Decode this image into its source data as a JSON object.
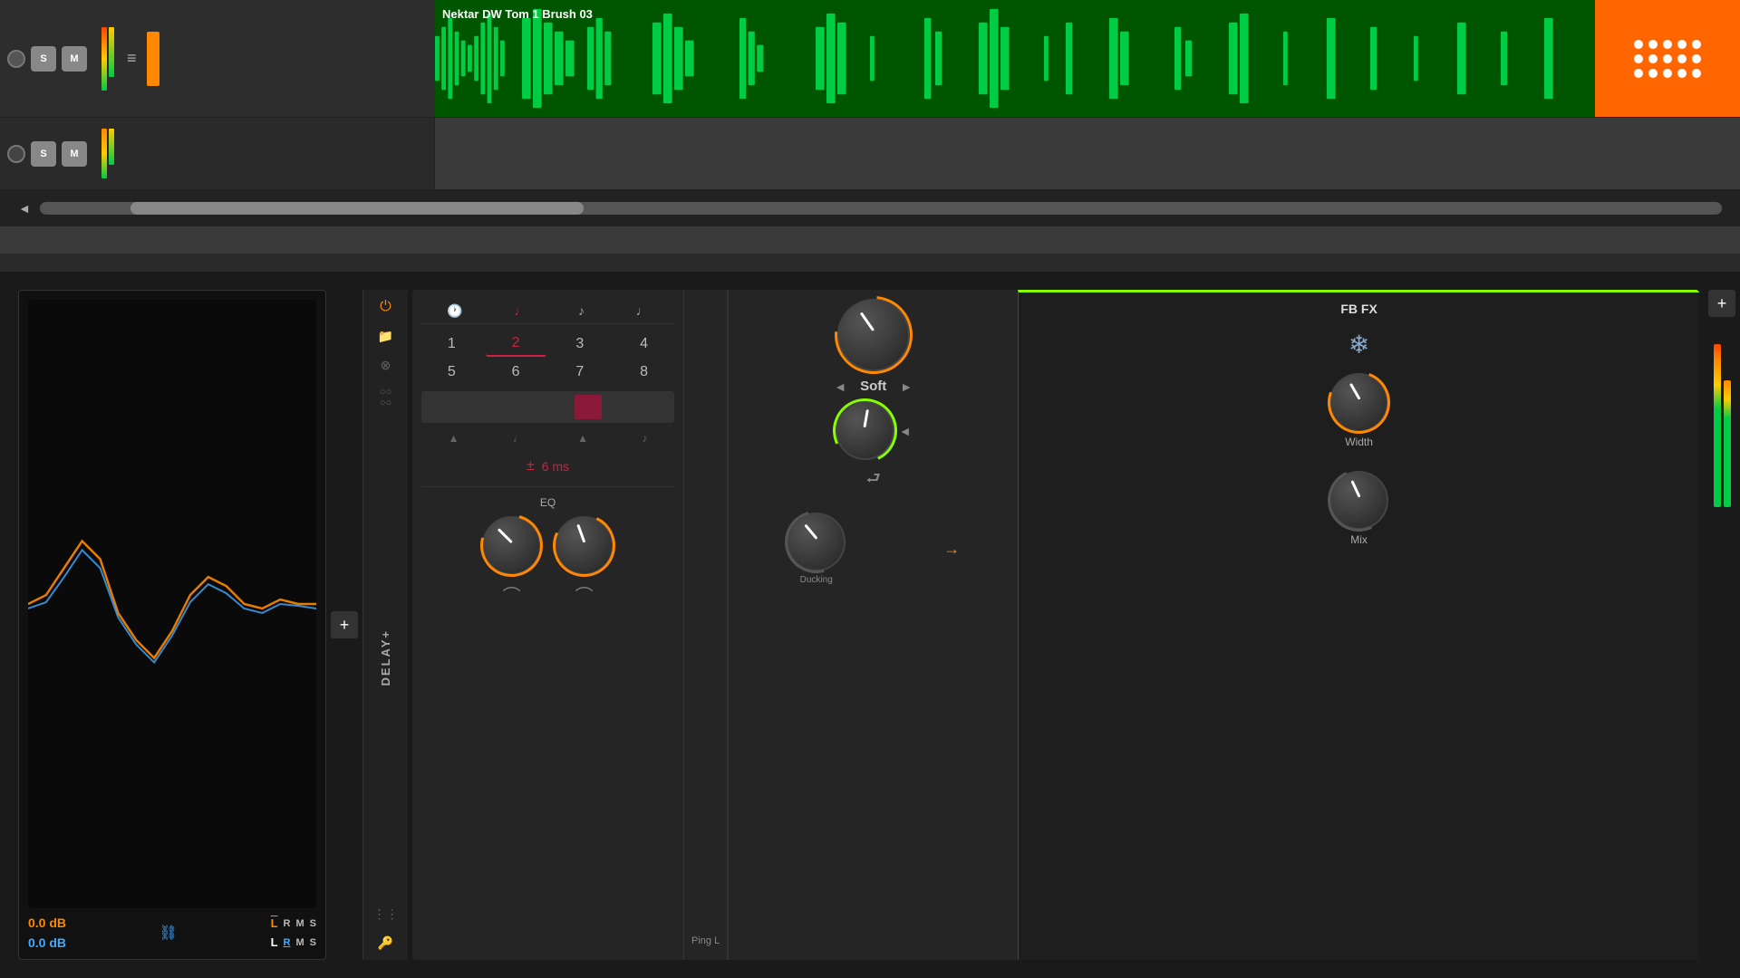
{
  "daw": {
    "track1": {
      "label": "Nektar DW Tom 1 Brush 03",
      "s_btn": "S",
      "m_btn": "M"
    },
    "track2": {
      "s_btn": "S",
      "m_btn": "M"
    }
  },
  "plugin": {
    "title": "DELAY+",
    "fb_fx_label": "FB FX",
    "timing": {
      "nums": [
        "1",
        "2",
        "3",
        "4",
        "5",
        "6",
        "7",
        "8"
      ],
      "active": "2",
      "ms_label": "6 ms"
    },
    "eq": {
      "label": "EQ",
      "ping_label": "Ping L"
    },
    "soft": {
      "label": "Soft",
      "nav_left": "◄",
      "nav_right": "►"
    },
    "width": {
      "label": "Width"
    },
    "ducking": {
      "label": "Ducking"
    },
    "mix": {
      "label": "Mix"
    }
  },
  "scope": {
    "db_orange": "0.0 dB",
    "db_blue": "0.0 dB",
    "l_label": "L",
    "r_label": "R",
    "m_label": "M",
    "s_label": "S"
  },
  "colors": {
    "orange": "#ff8800",
    "green": "#00cc44",
    "red": "#cc2244",
    "blue": "#44aaff",
    "accent_green": "#88ff00"
  }
}
